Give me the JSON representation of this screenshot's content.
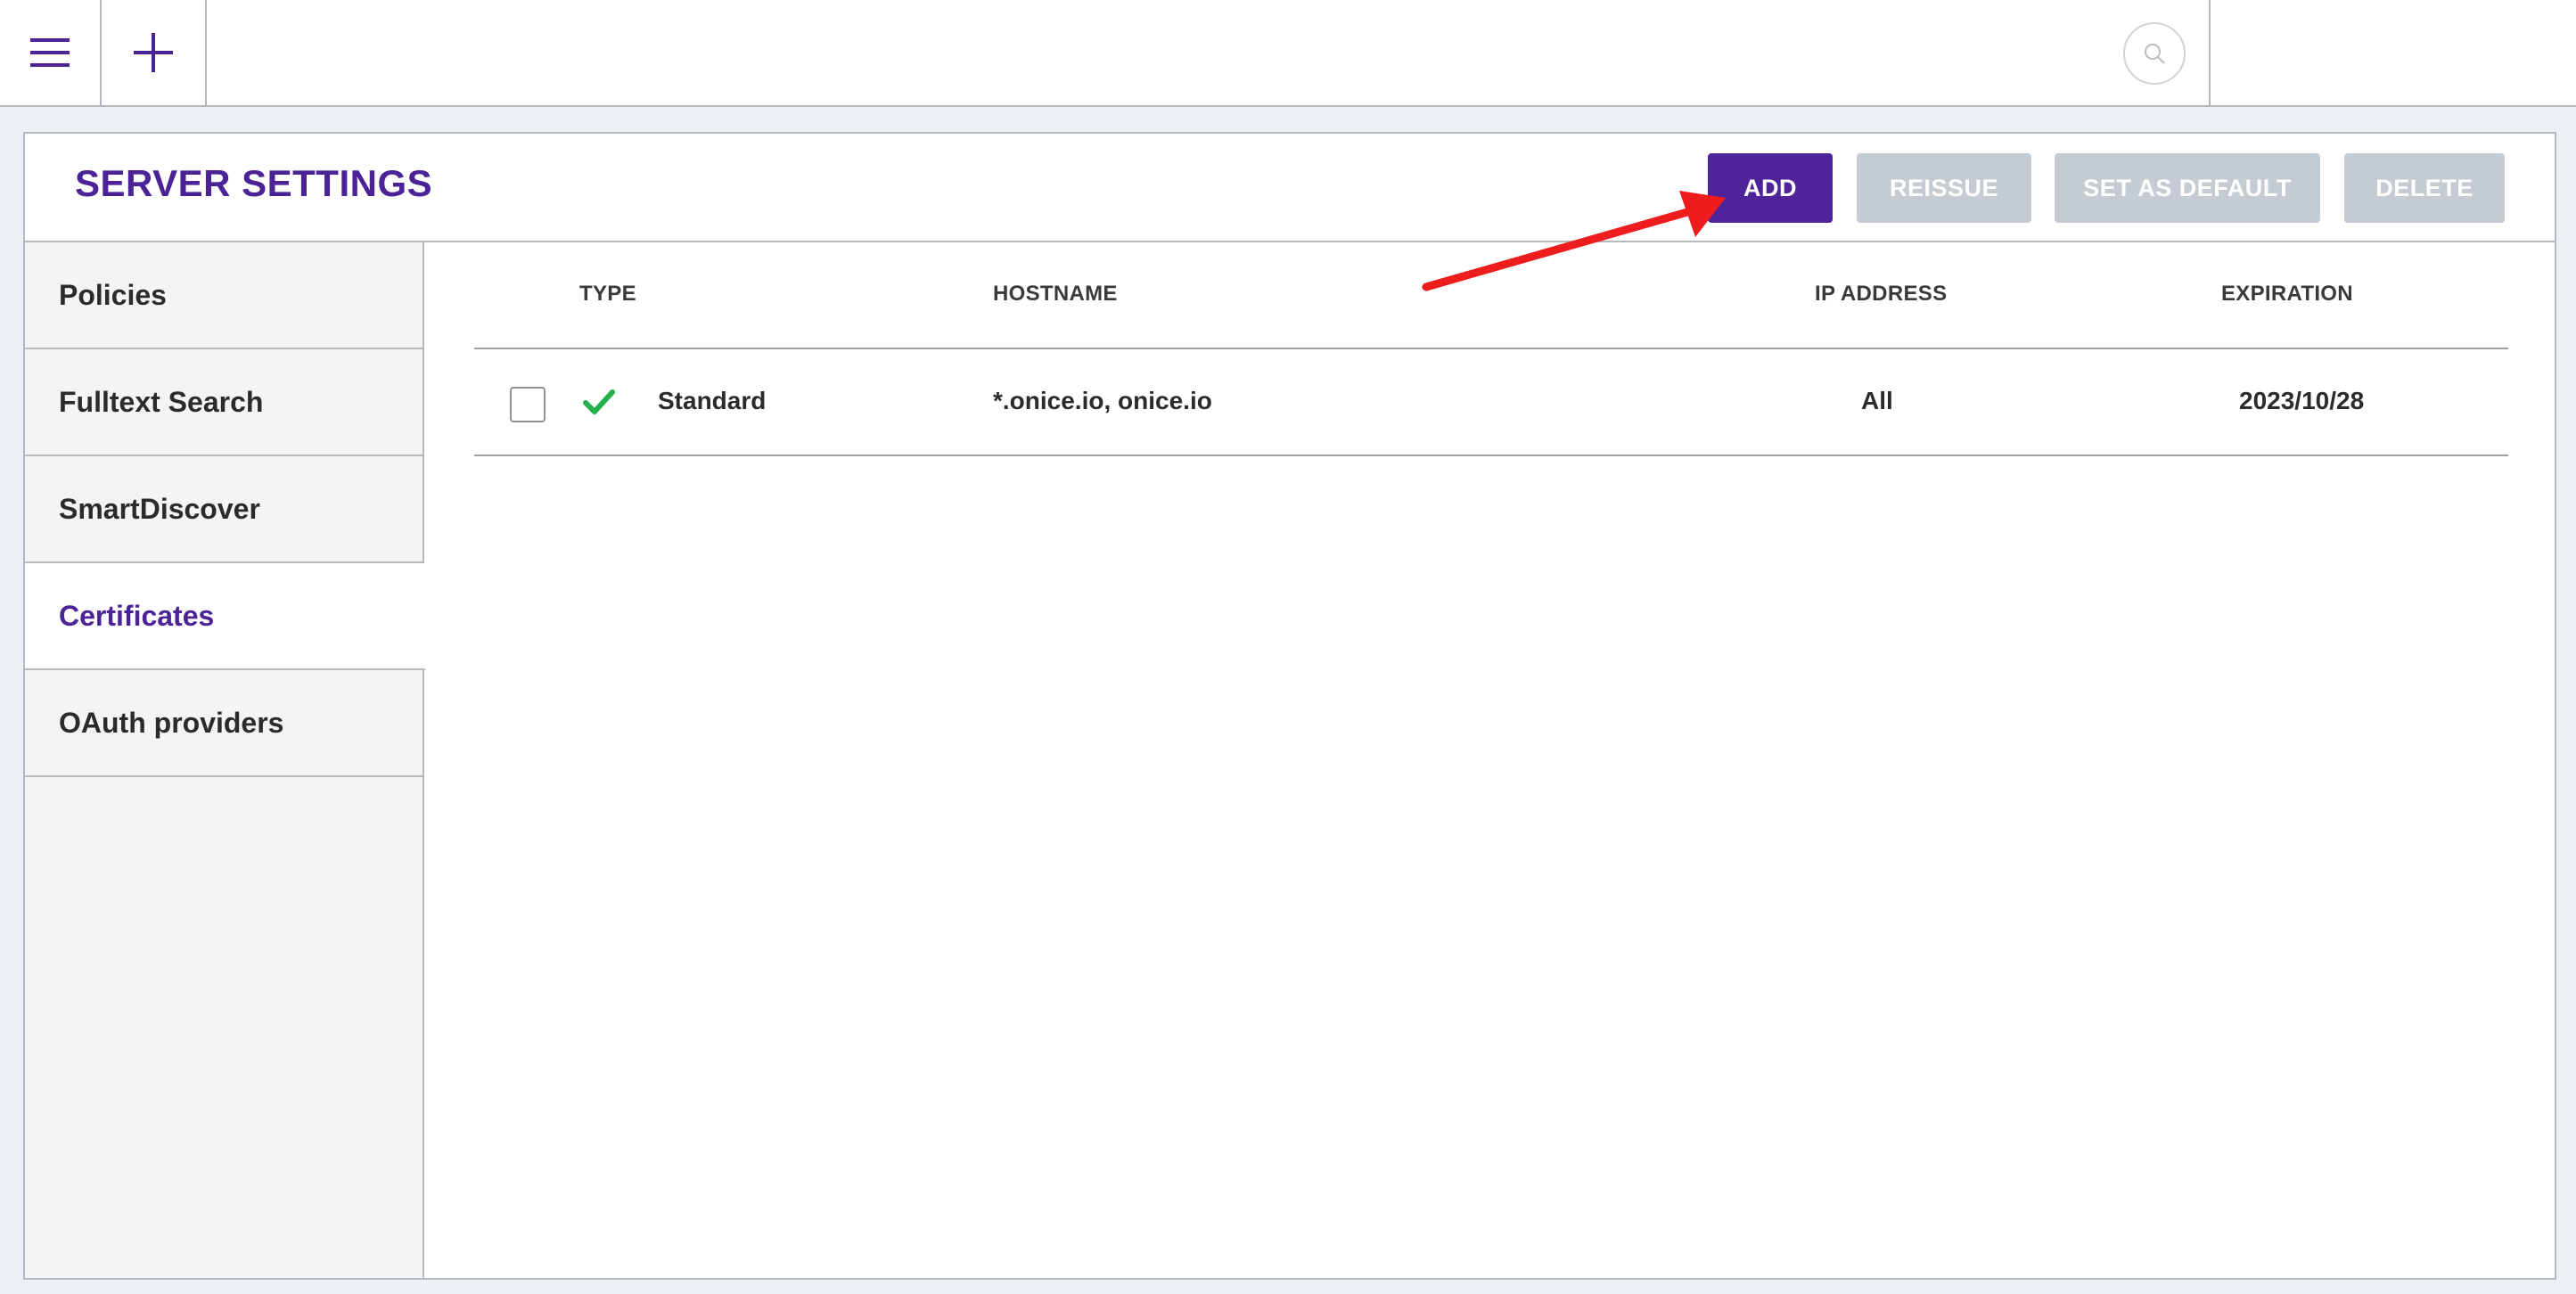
{
  "topbar": {
    "menu_icon": "hamburger-menu-icon",
    "add_icon": "plus-icon",
    "search_icon": "search-icon"
  },
  "header": {
    "title": "SERVER SETTINGS",
    "buttons": {
      "add": "ADD",
      "reissue": "REISSUE",
      "set_default": "SET AS DEFAULT",
      "delete": "DELETE"
    }
  },
  "sidebar": {
    "items": [
      {
        "label": "Policies"
      },
      {
        "label": "Fulltext Search"
      },
      {
        "label": "SmartDiscover"
      },
      {
        "label": "Certificates",
        "active": true
      },
      {
        "label": "OAuth providers"
      }
    ]
  },
  "table": {
    "columns": [
      "TYPE",
      "HOSTNAME",
      "IP ADDRESS",
      "EXPIRATION"
    ],
    "rows": [
      {
        "type": "Standard",
        "hostname": "*.onice.io, onice.io",
        "ip": "All",
        "expiration": "2023/10/28",
        "status_icon": "checkmark-icon"
      }
    ]
  },
  "colors": {
    "accent": "#4f2399",
    "disabled_button": "#c5cbd2",
    "status_ok": "#22b14c",
    "annotation": "#ee1c1c"
  }
}
